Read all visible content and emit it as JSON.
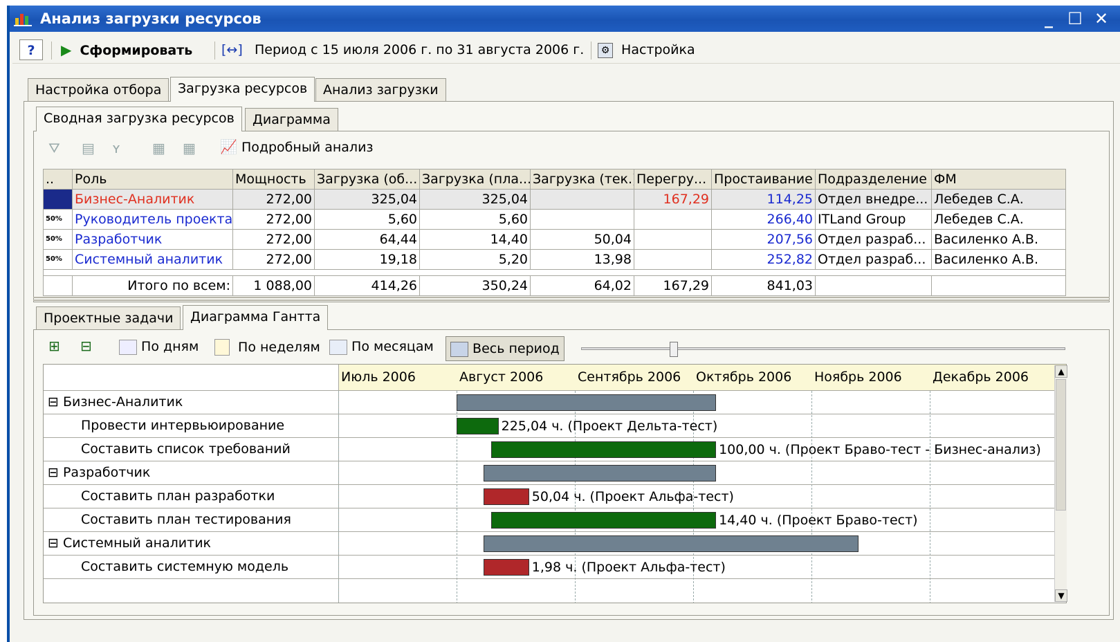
{
  "window": {
    "title": "Анализ загрузки ресурсов"
  },
  "toolbar": {
    "help": "?",
    "generate": "Сформировать",
    "period_icon": "[↔]",
    "period": "Период с 15 июля 2006 г. по 31 августа 2006 г.",
    "settings": "Настройка"
  },
  "main_tabs": [
    "Настройка отбора",
    "Загрузка ресурсов",
    "Анализ загрузки"
  ],
  "sub_tabs": [
    "Сводная загрузка ресурсов",
    "Диаграмма"
  ],
  "grid_toolbar": {
    "detail_analysis": "Подробный анализ"
  },
  "table": {
    "headers": [
      "..",
      "Роль",
      "Мощность",
      "Загрузка (об...",
      "Загрузка (пла...",
      "Загрузка (тек.)",
      "Перегру...",
      "Простаивание",
      "Подразделение",
      "ФМ"
    ],
    "rows": [
      {
        "badge": "",
        "role": "Бизнес-Аналитик",
        "power": "272,00",
        "load_total": "325,04",
        "load_plan": "325,04",
        "load_cur": "",
        "over": "167,29",
        "idle": "114,25",
        "dept": "Отдел внедре...",
        "fm": "Лебедев С.А."
      },
      {
        "badge": "50%",
        "role": "Руководитель проекта",
        "power": "272,00",
        "load_total": "5,60",
        "load_plan": "5,60",
        "load_cur": "",
        "over": "",
        "idle": "266,40",
        "dept": "ITLand Group",
        "fm": "Лебедев С.А."
      },
      {
        "badge": "50%",
        "role": "Разработчик",
        "power": "272,00",
        "load_total": "64,44",
        "load_plan": "14,40",
        "load_cur": "50,04",
        "over": "",
        "idle": "207,56",
        "dept": "Отдел разраб...",
        "fm": "Василенко А.В."
      },
      {
        "badge": "50%",
        "role": "Системный аналитик",
        "power": "272,00",
        "load_total": "19,18",
        "load_plan": "5,20",
        "load_cur": "13,98",
        "over": "",
        "idle": "252,82",
        "dept": "Отдел разраб...",
        "fm": "Василенко А.В."
      }
    ],
    "total": {
      "label": "Итого по всем:",
      "power": "1 088,00",
      "load_total": "414,26",
      "load_plan": "350,24",
      "load_cur": "64,02",
      "over": "167,29",
      "idle": "841,03"
    },
    "colors": {
      "overload": "#e03020",
      "idle": "#1a2ad0",
      "role_selected": "#e03020",
      "role": "#1a2ad0"
    }
  },
  "bottom_tabs": [
    "Проектные задачи",
    "Диаграмма Гантта"
  ],
  "gantt_toolbar": {
    "by_days": "По дням",
    "by_weeks": "По неделям",
    "by_months": "По месяцам",
    "whole_period": "Весь период"
  },
  "gantt": {
    "months": [
      "Июль 2006",
      "Август 2006",
      "Сентябрь 2006",
      "Октябрь 2006",
      "Ноябрь 2006",
      "Декабрь 2006"
    ],
    "rows": [
      {
        "label": "Бизнес-Аналитик",
        "group": true,
        "bar": "grey",
        "start": "2006-08-01",
        "end": "2006-10-07",
        "text": ""
      },
      {
        "label": "Провести интервьюирование",
        "group": false,
        "bar": "green",
        "start": "2006-08-01",
        "end": "2006-08-12",
        "text": "225,04 ч. (Проект Дельта-тест)"
      },
      {
        "label": "Составить список требований",
        "group": false,
        "bar": "green",
        "start": "2006-08-10",
        "end": "2006-10-07",
        "text": "100,00 ч. (Проект Браво-тест - Бизнес-анализ)"
      },
      {
        "label": "Разработчик",
        "group": true,
        "bar": "grey",
        "start": "2006-08-08",
        "end": "2006-10-07",
        "text": ""
      },
      {
        "label": "Составить план разработки",
        "group": false,
        "bar": "red",
        "start": "2006-08-08",
        "end": "2006-08-20",
        "text": "50,04 ч. (Проект Альфа-тест)"
      },
      {
        "label": "Составить план тестирования",
        "group": false,
        "bar": "green",
        "start": "2006-08-10",
        "end": "2006-10-07",
        "text": "14,40 ч. (Проект Браво-тест)"
      },
      {
        "label": "Системный аналитик",
        "group": true,
        "bar": "grey",
        "start": "2006-08-08",
        "end": "2006-11-13",
        "text": ""
      },
      {
        "label": "Составить системную модель",
        "group": false,
        "bar": "red",
        "start": "2006-08-08",
        "end": "2006-08-20",
        "text": "1,98 ч. (Проект Альфа-тест)"
      }
    ]
  }
}
